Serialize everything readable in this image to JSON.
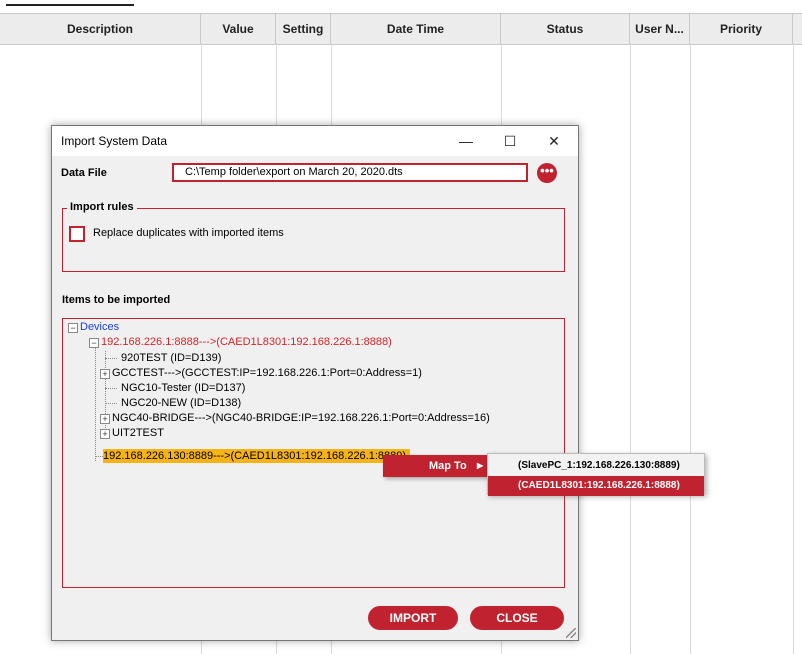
{
  "grid": {
    "columns": [
      "Description",
      "Value",
      "Setting",
      "Date Time",
      "Status",
      "User N...",
      "Priority"
    ]
  },
  "dialog": {
    "title": "Import System Data",
    "window_buttons": {
      "minimize": "—",
      "maximize": "☐",
      "close": "✕"
    },
    "data_file_label": "Data File",
    "data_file_value": "C:\\Temp folder\\export on March 20, 2020.dts",
    "browse_button": "•••",
    "import_rules_label": "Import rules",
    "replace_duplicates_label": "Replace duplicates with imported items",
    "replace_duplicates_checked": false,
    "items_label": "Items  to be imported",
    "tree": {
      "root": "Devices",
      "node1": "192.168.226.1:8888--->(CAED1L8301:192.168.226.1:8888)",
      "node1_children": [
        "920TEST (ID=D139)",
        "GCCTEST--->(GCCTEST:IP=192.168.226.1:Port=0:Address=1)",
        "NGC10-Tester (ID=D137)",
        "NGC20-NEW (ID=D138)",
        "NGC40-BRIDGE--->(NGC40-BRIDGE:IP=192.168.226.1:Port=0:Address=16)",
        "UIT2TEST"
      ],
      "node2": "192.168.226.130:8889--->(CAED1L8301:192.168.226.1:8889)"
    },
    "import_button": "IMPORT",
    "close_button": "CLOSE"
  },
  "context_menu": {
    "map_to": "Map To",
    "arrow": "▶",
    "options": [
      "(SlavePC_1:192.168.226.130:8889)",
      "(CAED1L8301:192.168.226.1:8888)"
    ],
    "selected_option": "(CAED1L8301:192.168.226.1:8888)"
  },
  "colors": {
    "accent": "#c0232f",
    "highlight": "#f5b316",
    "tree_root": "#1a3fd6",
    "tree_node_error": "#d8242a"
  }
}
